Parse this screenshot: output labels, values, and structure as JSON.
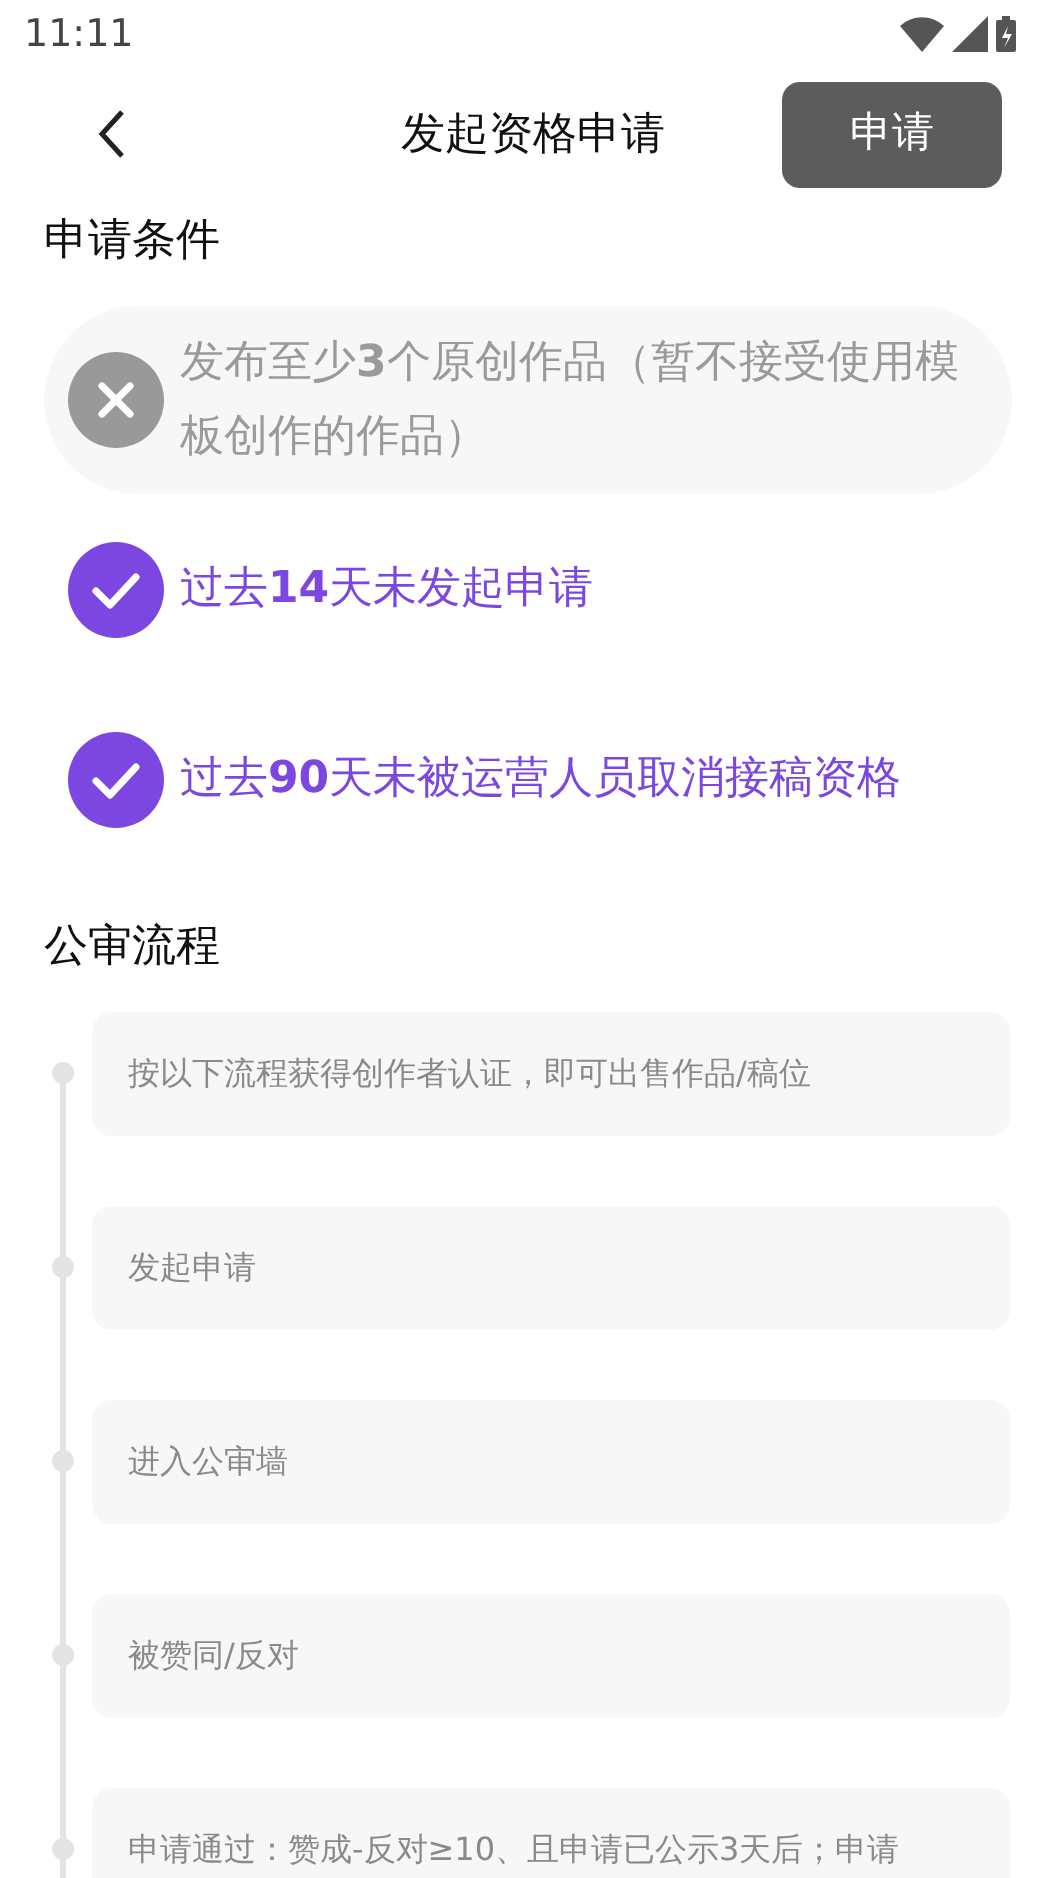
{
  "status_bar": {
    "time": "11:11"
  },
  "header": {
    "title": "发起资格申请",
    "action": "申请"
  },
  "conditions_section": {
    "title": "申请条件",
    "items": [
      {
        "text": "发布至少**3**个原创作品（暂不接受使用模板创作的作品）",
        "met": false
      },
      {
        "text": "过去**14**天未发起申请",
        "met": true
      },
      {
        "text": "过去**90**天未被运营人员取消接稿资格",
        "met": true
      }
    ]
  },
  "process_section": {
    "title": "公审流程",
    "steps": [
      {
        "text": "按以下流程获得创作者认证，即可出售作品/稿位"
      },
      {
        "text": "发起申请"
      },
      {
        "text": "进入公审墙"
      },
      {
        "text": "被赞同/反对"
      },
      {
        "text": "申请通过：赞成-反对≥10、且申请已公示3天后；申请"
      }
    ]
  }
}
